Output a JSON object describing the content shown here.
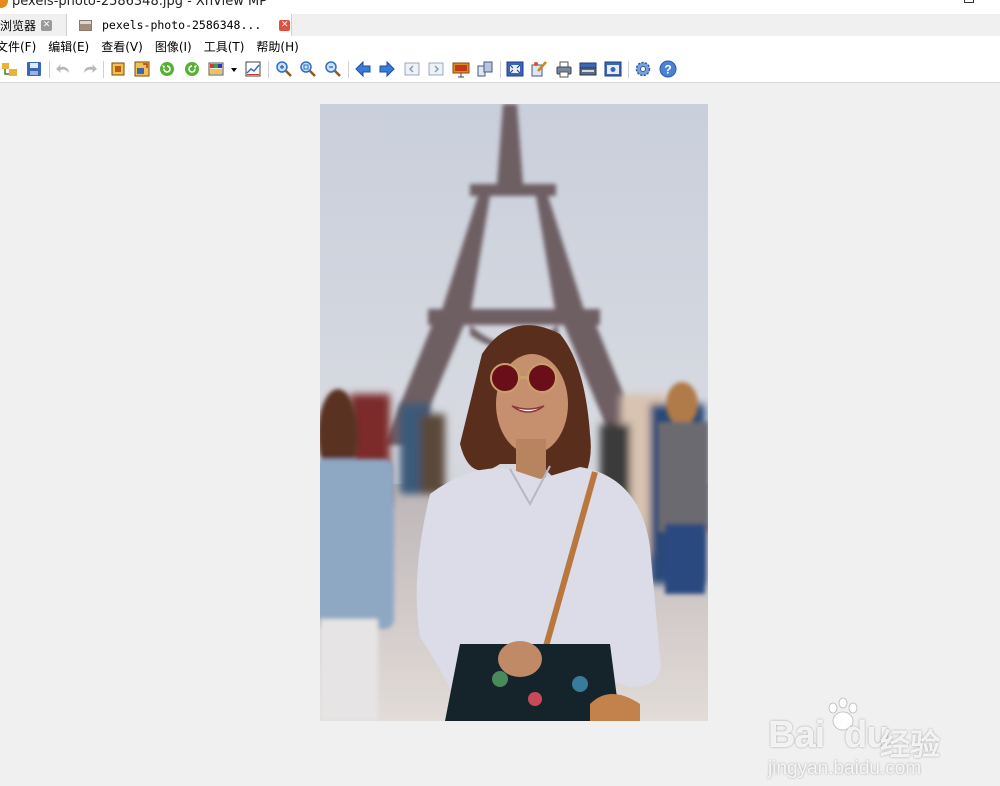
{
  "window": {
    "title": "pexels-photo-2586348.jpg - XnView MP",
    "app_icon": "xnview-app-icon"
  },
  "tabs": [
    {
      "label": "浏览器",
      "close_icon": "close-icon",
      "active": false
    },
    {
      "label": "pexels-photo-2586348...",
      "image_icon": "image-file-icon",
      "close_icon": "close-icon",
      "active": true
    }
  ],
  "menu": [
    "文件(F)",
    "编辑(E)",
    "查看(V)",
    "图像(I)",
    "工具(T)",
    "帮助(H)"
  ],
  "toolbar": {
    "icons": [
      "open-in-browser-icon",
      "save-icon",
      "undo-icon",
      "redo-icon",
      "crop-icon",
      "resize-icon",
      "rotate-left-icon",
      "rotate-right-icon",
      "adjust-colors-icon",
      "dropdown-arrow-icon",
      "histogram-icon",
      "zoom-in-icon",
      "zoom-fit-icon",
      "zoom-out-icon",
      "previous-image-icon",
      "next-image-icon",
      "first-page-icon",
      "last-page-icon",
      "slideshow-icon",
      "compare-icon",
      "fullscreen-icon",
      "edit-paint-icon",
      "print-icon",
      "scanner-icon",
      "capture-icon",
      "settings-icon",
      "help-icon"
    ]
  },
  "viewer": {
    "image_description": "Woman in sunglasses and white shirt smiling in front of the Eiffel Tower"
  },
  "watermark": {
    "brand": "Bai",
    "brand_suffix": "du",
    "chinese": "经验",
    "url": "jingyan.baidu.com"
  },
  "colors": {
    "toolbar_blue": "#2f6fc4",
    "accent_orange": "#e8891c",
    "close_red": "#e0503c",
    "viewer_bg": "#f0f0f0"
  }
}
